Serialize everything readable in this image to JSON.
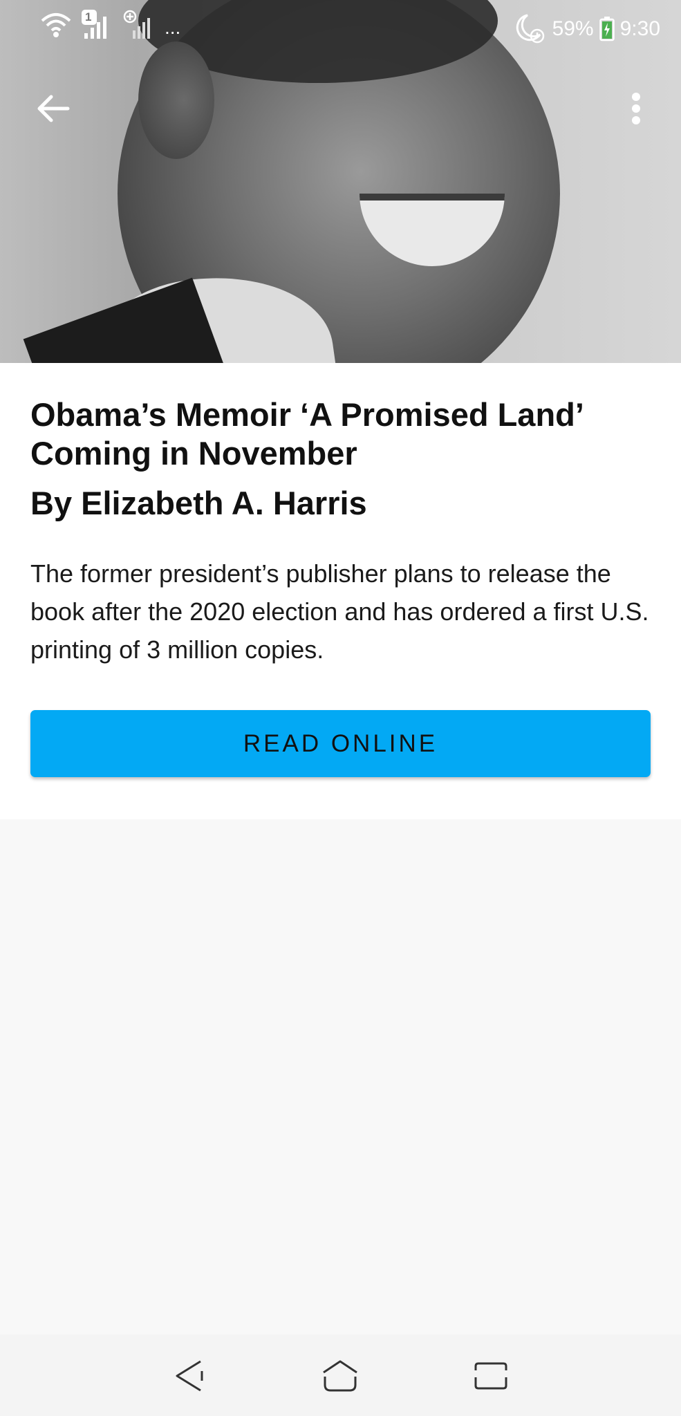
{
  "status_bar": {
    "sim_badge": "1",
    "overflow": "...",
    "battery_percent": "59%",
    "time": "9:30",
    "icons": [
      "wifi-icon",
      "signal-icon",
      "signal-icon",
      "do-not-disturb-icon",
      "alarm-icon",
      "battery-charging-icon"
    ]
  },
  "toolbar": {
    "back_icon": "arrow-left-icon",
    "more_icon": "more-vertical-icon"
  },
  "hero": {
    "image": "portrait photo (grayscale)"
  },
  "article": {
    "headline": "Obama’s Memoir ‘A Promised Land’ Coming in November",
    "byline": "By Elizabeth A. Harris",
    "summary": "The former president’s publisher plans to release the book after the 2020 election and has ordered a first U.S. printing of 3 million copies.",
    "read_button_label": "READ ONLINE"
  },
  "nav_bar": {
    "icons": [
      "nav-back-icon",
      "nav-home-icon",
      "nav-recents-icon"
    ]
  },
  "colors": {
    "accent": "#03a9f4",
    "card_background": "#ffffff",
    "page_background": "#f8f8f8",
    "text": "#111111",
    "status_text": "#ffffff"
  }
}
